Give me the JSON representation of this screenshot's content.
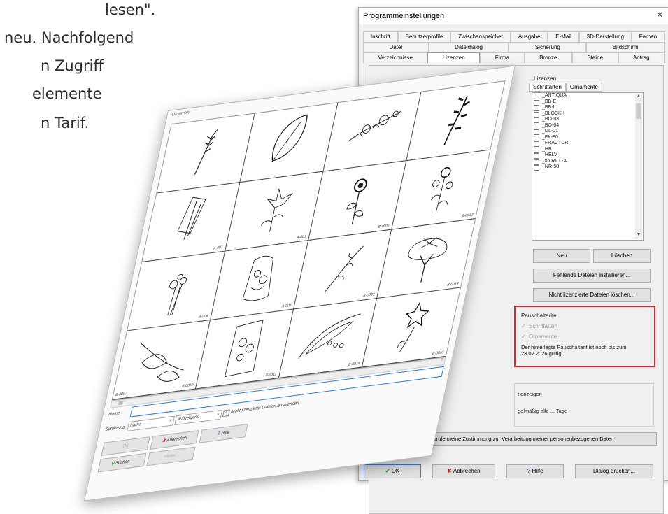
{
  "promo": {
    "line1": "lesen\".",
    "line2": "neu. Nachfolgend",
    "line3": "n Zugriff",
    "line4": "elemente",
    "line5": "n Tarif."
  },
  "settings_dialog": {
    "title": "Programmeinstellungen",
    "close_glyph": "×",
    "tabs_row1": [
      "Inschrift",
      "Benutzerprofile",
      "Zwischenspeicher",
      "Ausgabe",
      "E-Mail",
      "3D-Darstellung",
      "Farben"
    ],
    "tabs_row2": [
      "Datei",
      "Dateidialog",
      "Sicherung",
      "Bildschirm"
    ],
    "tabs_row3": [
      "Verzeichnisse",
      "Lizenzen",
      "Firma",
      "Bronze",
      "Steine",
      "Antrag"
    ],
    "active_tab": "Lizenzen",
    "licenses_group": "Lizenzen",
    "subtabs": [
      "Schriftarten",
      "Ornamente"
    ],
    "font_list": [
      "_ANTIQUA",
      "_BB-E",
      "_BB-I",
      "_BLOCK-I",
      "_BO-03",
      "_BO-04",
      "_DL-01",
      "_FK-90",
      "_FRACTUR",
      "_HB",
      "_HELV",
      "_KYRILL-A",
      "_NR-58"
    ],
    "btn_new": "Neu",
    "btn_delete": "Löschen",
    "btn_install_missing": "Fehlende Dateien installieren...",
    "btn_delete_unlicensed": "Nicht lizenzierte Dateien löschen...",
    "flat_rate": {
      "title": "Pauschaltarife",
      "opt_fonts": "Schriftarten",
      "opt_ornaments": "Ornamente",
      "note": "Der hinterlegte Pauschaltarif ist noch bis zum 23.02.2026 gültig."
    },
    "update_check_label": "t anzeigen",
    "update_interval_label": "gelmäßig alle ... Tage",
    "btn_revoke": "Ich widerrufe meine Zustimmung zur Verarbeitung meiner personenbezogenen Daten",
    "btn_ok": "OK",
    "btn_cancel": "Abbrechen",
    "btn_help": "Hilfe",
    "btn_print": "Dialog drucken..."
  },
  "ornament_dialog": {
    "title": "Ornament",
    "cells": [
      {
        "code": "",
        "shape": "wheat"
      },
      {
        "code": "",
        "shape": "leaf"
      },
      {
        "code": "",
        "shape": "flowers"
      },
      {
        "code": "",
        "shape": "branch"
      },
      {
        "code": "A-001",
        "shape": "reed"
      },
      {
        "code": "A-003",
        "shape": "lily"
      },
      {
        "code": "B-0006",
        "shape": "sunflower"
      },
      {
        "code": "B-0013",
        "shape": "blossom"
      },
      {
        "code": "A-004",
        "shape": "bouquet"
      },
      {
        "code": "A-005",
        "shape": "vase"
      },
      {
        "code": "B-0009",
        "shape": "spray"
      },
      {
        "code": "B-0014",
        "shape": "tree"
      },
      {
        "code": "B-0010",
        "shape": "leaves"
      },
      {
        "code": "B-0011",
        "shape": "basket"
      },
      {
        "code": "B-0016",
        "shape": "curve"
      },
      {
        "code": "B-0018",
        "shape": "star"
      }
    ],
    "row_label": "B-0007",
    "name_label": "Name",
    "sort_label": "Sortierung",
    "sort_select": "Name",
    "order_select": "aufsteigend",
    "hide_unlicensed": "Nicht lizenzierte Dateien ausblenden",
    "btn_ok": "OK",
    "btn_cancel": "Abbrechen",
    "btn_help": "Hilfe",
    "btn_search": "Suchen...",
    "btn_next": "Weiter..."
  },
  "colors": {
    "highlight": "#d9272e",
    "focus": "#2b7de9"
  }
}
